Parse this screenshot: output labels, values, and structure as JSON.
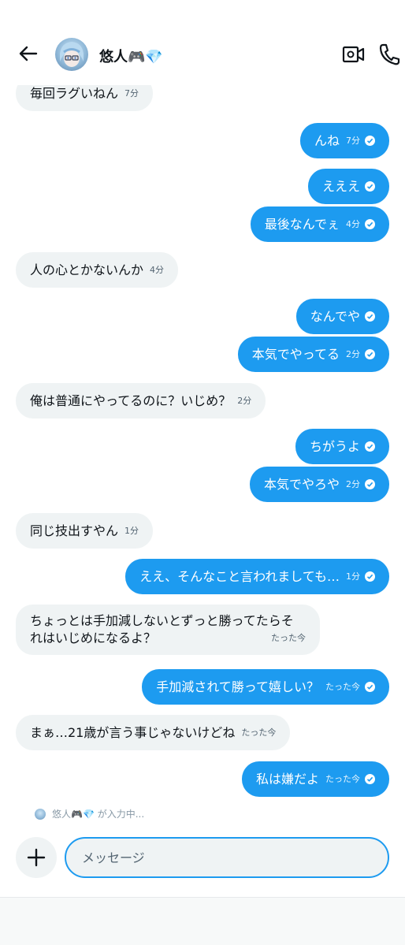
{
  "header": {
    "title": "悠人🎮💎",
    "back_icon": "arrow-left-icon",
    "video_icon": "video-icon",
    "phone_icon": "phone-icon"
  },
  "messages": [
    {
      "dir": "in",
      "text": "毎回ラグいねん",
      "time": "7分"
    },
    {
      "dir": "out",
      "text": "んね",
      "time": "7分"
    },
    {
      "dir": "out",
      "text": "えええ",
      "time": ""
    },
    {
      "dir": "out",
      "text": "最後なんでぇ",
      "time": "4分"
    },
    {
      "dir": "in",
      "text": "人の心とかないんか",
      "time": "4分"
    },
    {
      "dir": "out",
      "text": "なんでや",
      "time": ""
    },
    {
      "dir": "out",
      "text": "本気でやってる",
      "time": "2分"
    },
    {
      "dir": "in",
      "text": "俺は普通にやってるのに？いじめ？",
      "time": "2分"
    },
    {
      "dir": "out",
      "text": "ちがうよ",
      "time": ""
    },
    {
      "dir": "out",
      "text": "本気でやろや",
      "time": "2分"
    },
    {
      "dir": "in",
      "text": "同じ技出すやん",
      "time": "1分"
    },
    {
      "dir": "out",
      "text": "ええ、そんなこと言われましても…",
      "time": "1分"
    },
    {
      "dir": "in",
      "text_line1": "ちょっとは手加減しないとずっと勝ってたらそ",
      "text_line2": "れはいじめになるよ？",
      "time": "たった今"
    },
    {
      "dir": "out",
      "text": "手加減されて勝って嬉しい？",
      "time": "たった今"
    },
    {
      "dir": "in",
      "text": "まぁ…21歳が言う事じゃないけどね",
      "time": "たった今"
    },
    {
      "dir": "out",
      "text": "私は嫌だよ",
      "time": "たった今"
    }
  ],
  "typing_indicator": "悠人🎮💎 が入力中...",
  "composer": {
    "placeholder": "メッセージ",
    "value": "",
    "add_icon": "plus-icon"
  },
  "colors": {
    "accent": "#1d9bf0",
    "incoming_bubble": "#eff3f4"
  }
}
